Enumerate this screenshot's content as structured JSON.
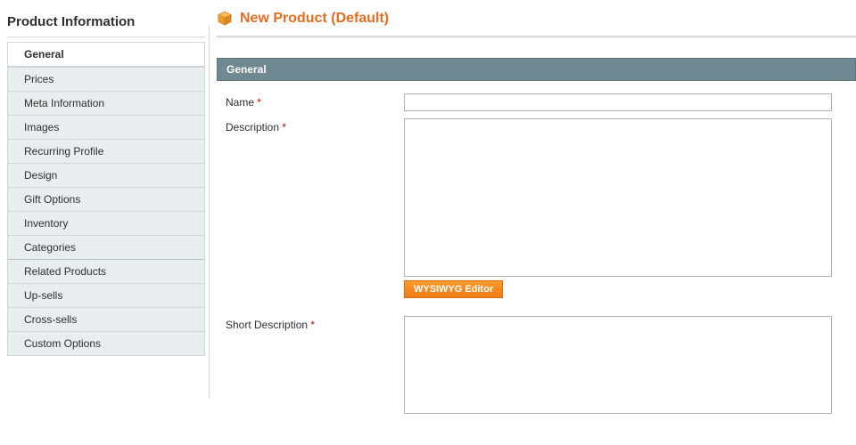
{
  "sidebar": {
    "title": "Product Information",
    "tabs": [
      {
        "label": "General"
      },
      {
        "label": "Prices"
      },
      {
        "label": "Meta Information"
      },
      {
        "label": "Images"
      },
      {
        "label": "Recurring Profile"
      },
      {
        "label": "Design"
      },
      {
        "label": "Gift Options"
      },
      {
        "label": "Inventory"
      },
      {
        "label": "Categories"
      },
      {
        "label": "Related Products"
      },
      {
        "label": "Up-sells"
      },
      {
        "label": "Cross-sells"
      },
      {
        "label": "Custom Options"
      }
    ]
  },
  "page": {
    "title": "New Product (Default)"
  },
  "section": {
    "header": "General"
  },
  "form": {
    "name": {
      "label": "Name",
      "value": ""
    },
    "description": {
      "label": "Description",
      "value": ""
    },
    "short_description": {
      "label": "Short Description",
      "value": ""
    },
    "wysiwyg_button": "WYSIWYG Editor",
    "required_mark": "*"
  }
}
